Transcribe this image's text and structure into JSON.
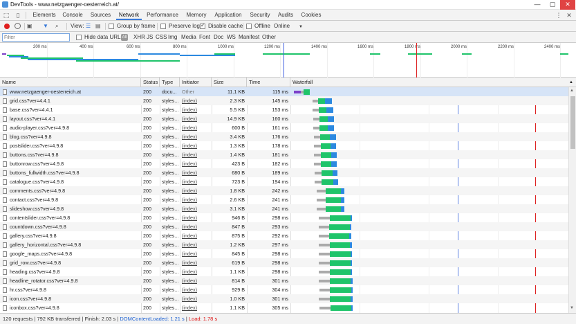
{
  "titlebar": {
    "title": "DevTools - www.netzgaenger-oesterreich.at/",
    "minimize": "—",
    "maximize": "▢",
    "close": "✕"
  },
  "tabs": [
    "Elements",
    "Console",
    "Sources",
    "Network",
    "Performance",
    "Memory",
    "Application",
    "Security",
    "Audits",
    "Cookies"
  ],
  "active_tab": "Network",
  "toolbar": {
    "view_label": "View:",
    "group_by_frame": "Group by frame",
    "preserve_log": "Preserve log",
    "disable_cache": "Disable cache",
    "offline": "Offline",
    "throttle": "Online",
    "dropdown_arrow": "▼"
  },
  "filterbar": {
    "placeholder": "Filter",
    "hide_data_urls": "Hide data URLs",
    "all": "All",
    "types": [
      "XHR",
      "JS",
      "CSS",
      "Img",
      "Media",
      "Font",
      "Doc",
      "WS",
      "Manifest",
      "Other"
    ]
  },
  "overview": {
    "ticks": [
      "200 ms",
      "400 ms",
      "600 ms",
      "800 ms",
      "1000 ms",
      "1200 ms",
      "1400 ms",
      "1600 ms",
      "1800 ms",
      "2000 ms",
      "2200 ms",
      "2400 ms"
    ]
  },
  "columns": {
    "name": "Name",
    "status": "Status",
    "type": "Type",
    "initiator": "Initiator",
    "size": "Size",
    "time": "Time",
    "waterfall": "Waterfall",
    "sort_arrow": "▲"
  },
  "rows": [
    {
      "name": "www.netzgaenger-oesterreich.at",
      "status": "200",
      "type": "docu...",
      "initiator": "Other",
      "size": "11.1 KB",
      "time": "115 ms"
    },
    {
      "name": "grid.css?ver=4.4.1",
      "status": "200",
      "type": "styles...",
      "initiator": "(index)",
      "size": "2.3 KB",
      "time": "145 ms"
    },
    {
      "name": "base.css?ver=4.4.1",
      "status": "200",
      "type": "styles...",
      "initiator": "(index)",
      "size": "5.5 KB",
      "time": "153 ms"
    },
    {
      "name": "layout.css?ver=4.4.1",
      "status": "200",
      "type": "styles...",
      "initiator": "(index)",
      "size": "14.9 KB",
      "time": "160 ms"
    },
    {
      "name": "audio-player.css?ver=4.9.8",
      "status": "200",
      "type": "styles...",
      "initiator": "(index)",
      "size": "600 B",
      "time": "161 ms"
    },
    {
      "name": "blog.css?ver=4.9.8",
      "status": "200",
      "type": "styles...",
      "initiator": "(index)",
      "size": "3.4 KB",
      "time": "176 ms"
    },
    {
      "name": "postslider.css?ver=4.9.8",
      "status": "200",
      "type": "styles...",
      "initiator": "(index)",
      "size": "1.3 KB",
      "time": "178 ms"
    },
    {
      "name": "buttons.css?ver=4.9.8",
      "status": "200",
      "type": "styles...",
      "initiator": "(index)",
      "size": "1.4 KB",
      "time": "181 ms"
    },
    {
      "name": "buttonrow.css?ver=4.9.8",
      "status": "200",
      "type": "styles...",
      "initiator": "(index)",
      "size": "423 B",
      "time": "182 ms"
    },
    {
      "name": "buttons_fullwidth.css?ver=4.9.8",
      "status": "200",
      "type": "styles...",
      "initiator": "(index)",
      "size": "680 B",
      "time": "189 ms"
    },
    {
      "name": "catalogue.css?ver=4.9.8",
      "status": "200",
      "type": "styles...",
      "initiator": "(index)",
      "size": "723 B",
      "time": "194 ms"
    },
    {
      "name": "comments.css?ver=4.9.8",
      "status": "200",
      "type": "styles...",
      "initiator": "(index)",
      "size": "1.8 KB",
      "time": "242 ms"
    },
    {
      "name": "contact.css?ver=4.9.8",
      "status": "200",
      "type": "styles...",
      "initiator": "(index)",
      "size": "2.6 KB",
      "time": "241 ms"
    },
    {
      "name": "slideshow.css?ver=4.9.8",
      "status": "200",
      "type": "styles...",
      "initiator": "(index)",
      "size": "3.1 KB",
      "time": "241 ms"
    },
    {
      "name": "contentslider.css?ver=4.9.8",
      "status": "200",
      "type": "styles...",
      "initiator": "(index)",
      "size": "946 B",
      "time": "298 ms"
    },
    {
      "name": "countdown.css?ver=4.9.8",
      "status": "200",
      "type": "styles...",
      "initiator": "(index)",
      "size": "847 B",
      "time": "293 ms"
    },
    {
      "name": "gallery.css?ver=4.9.8",
      "status": "200",
      "type": "styles...",
      "initiator": "(index)",
      "size": "875 B",
      "time": "292 ms"
    },
    {
      "name": "gallery_horizontal.css?ver=4.9.8",
      "status": "200",
      "type": "styles...",
      "initiator": "(index)",
      "size": "1.2 KB",
      "time": "297 ms"
    },
    {
      "name": "google_maps.css?ver=4.9.8",
      "status": "200",
      "type": "styles...",
      "initiator": "(index)",
      "size": "845 B",
      "time": "298 ms"
    },
    {
      "name": "grid_row.css?ver=4.9.8",
      "status": "200",
      "type": "styles...",
      "initiator": "(index)",
      "size": "619 B",
      "time": "298 ms"
    },
    {
      "name": "heading.css?ver=4.9.8",
      "status": "200",
      "type": "styles...",
      "initiator": "(index)",
      "size": "1.1 KB",
      "time": "298 ms"
    },
    {
      "name": "headline_rotator.css?ver=4.9.8",
      "status": "200",
      "type": "styles...",
      "initiator": "(index)",
      "size": "814 B",
      "time": "301 ms"
    },
    {
      "name": "hr.css?ver=4.9.8",
      "status": "200",
      "type": "styles...",
      "initiator": "(index)",
      "size": "929 B",
      "time": "304 ms"
    },
    {
      "name": "icon.css?ver=4.9.8",
      "status": "200",
      "type": "styles...",
      "initiator": "(index)",
      "size": "1.0 KB",
      "time": "301 ms"
    },
    {
      "name": "iconbox.css?ver=4.9.8",
      "status": "200",
      "type": "styles...",
      "initiator": "(index)",
      "size": "1.1 KB",
      "time": "305 ms"
    }
  ],
  "status": {
    "requests": "120 requests",
    "transferred": "792 KB transferred",
    "finish": "Finish: 2.03 s",
    "dcl": "DOMContentLoaded: 1.21 s",
    "load": "Load: 1.78 s",
    "separator": "|"
  },
  "colors": {
    "accent": "#3879d9",
    "waiting": "#aaaaaa",
    "download": "#1fc46a",
    "receiving": "#2c89e0",
    "dcl_line": "#1a5fd1",
    "load_line": "#dd2222"
  },
  "icons": {
    "record": "record-icon",
    "clear": "clear-icon",
    "filter": "filter-icon",
    "search": "search-icon",
    "list_view": "list-view-icon",
    "overview_view": "overview-view-icon"
  }
}
